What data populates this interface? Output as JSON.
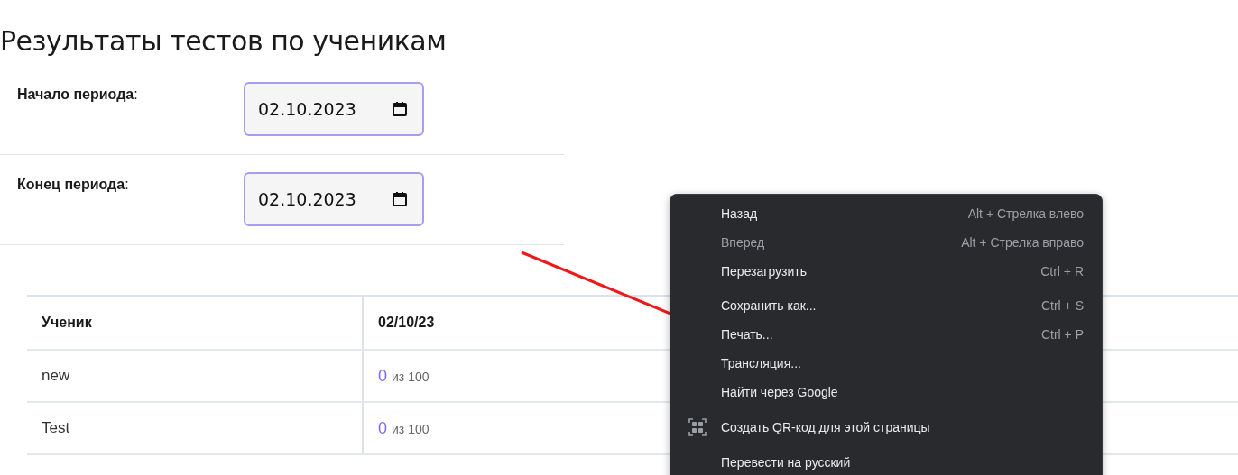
{
  "title": "Результаты тестов по ученикам",
  "filters": [
    {
      "label": "Начало периода",
      "colon": ":",
      "value": "02.10.2023"
    },
    {
      "label": "Конец периода",
      "colon": ":",
      "value": "02.10.2023"
    }
  ],
  "table": {
    "columns": [
      "Ученик",
      "02/10/23"
    ],
    "rows": [
      {
        "name": "new",
        "score": "0",
        "total": "из 100"
      },
      {
        "name": "Test",
        "score": "0",
        "total": "из 100"
      }
    ]
  },
  "context_menu": {
    "sections": [
      [
        {
          "kind": "item",
          "label": "Назад",
          "shortcut": "Alt + Стрелка влево",
          "disabled": false
        },
        {
          "kind": "item",
          "label": "Вперед",
          "shortcut": "Alt + Стрелка вправо",
          "disabled": true
        },
        {
          "kind": "item",
          "label": "Перезагрузить",
          "shortcut": "Ctrl + R",
          "disabled": false
        }
      ],
      [
        {
          "kind": "item",
          "label": "Сохранить как...",
          "shortcut": "Ctrl + S",
          "disabled": false
        },
        {
          "kind": "item",
          "label": "Печать...",
          "shortcut": "Ctrl + P",
          "disabled": false
        },
        {
          "kind": "item",
          "label": "Трансляция...",
          "disabled": false
        },
        {
          "kind": "item",
          "label": "Найти через Google",
          "disabled": false
        }
      ],
      [
        {
          "kind": "qr",
          "label": "Создать QR-код для этой страницы",
          "disabled": false
        }
      ],
      [
        {
          "kind": "item",
          "label": "Перевести на русский",
          "disabled": false
        }
      ]
    ]
  }
}
